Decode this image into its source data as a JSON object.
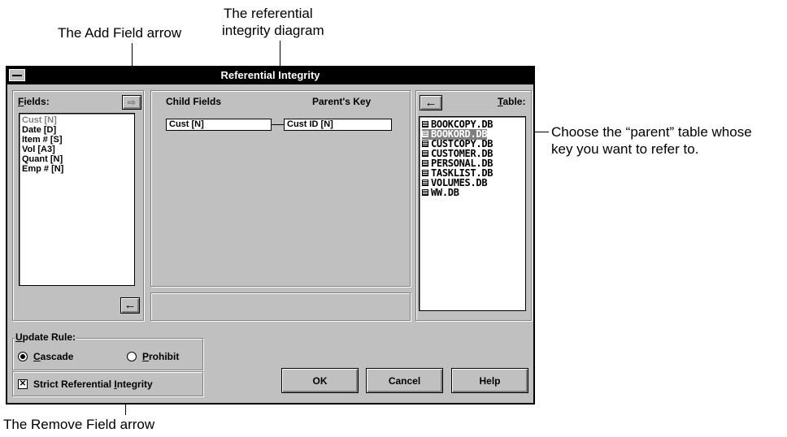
{
  "callouts": {
    "add_field": "The Add Field arrow",
    "referential_line1": "The referential",
    "referential_line2": "integrity diagram",
    "parent_line1": "Choose the “parent” table whose",
    "parent_line2": "key you want to refer to.",
    "remove_field": "The Remove Field arrow"
  },
  "dialog": {
    "title": "Referential Integrity",
    "fields_label_prefix": "F",
    "fields_label_rest": "ields:",
    "fields": [
      {
        "name": "Cust [N]",
        "dimmed": true
      },
      {
        "name": "Date [D]",
        "dimmed": false
      },
      {
        "name": "Item # [S]",
        "dimmed": false
      },
      {
        "name": "Vol [A3]",
        "dimmed": false
      },
      {
        "name": "Quant [N]",
        "dimmed": false
      },
      {
        "name": "Emp # [N]",
        "dimmed": false
      }
    ],
    "child_fields_header": "Child Fields",
    "parents_key_header": "Parent's Key",
    "child_field_value": "Cust [N]",
    "parent_key_value": "Cust ID [N]",
    "table_label_prefix": "T",
    "table_label_rest": "able:",
    "tables": [
      {
        "name": "BOOKCOPY.DB",
        "selected": false
      },
      {
        "name": "BOOKORD.DB",
        "selected": true
      },
      {
        "name": "CUSTCOPY.DB",
        "selected": false
      },
      {
        "name": "CUSTOMER.DB",
        "selected": false
      },
      {
        "name": "PERSONAL.DB",
        "selected": false
      },
      {
        "name": "TASKLIST.DB",
        "selected": false
      },
      {
        "name": "VOLUMES.DB",
        "selected": false
      },
      {
        "name": "WW.DB",
        "selected": false
      }
    ],
    "update_rule_prefix": "U",
    "update_rule_rest": "pdate Rule:",
    "cascade_prefix": "C",
    "cascade_rest": "ascade",
    "prohibit_prefix": "P",
    "prohibit_rest": "rohibit",
    "update_rule_selected": "Cascade",
    "strict_prefix": "Strict Referential ",
    "strict_underline": "I",
    "strict_rest": "ntegrity",
    "strict_checked": true,
    "ok_label": "OK",
    "cancel_label": "Cancel",
    "help_label": "Help"
  }
}
